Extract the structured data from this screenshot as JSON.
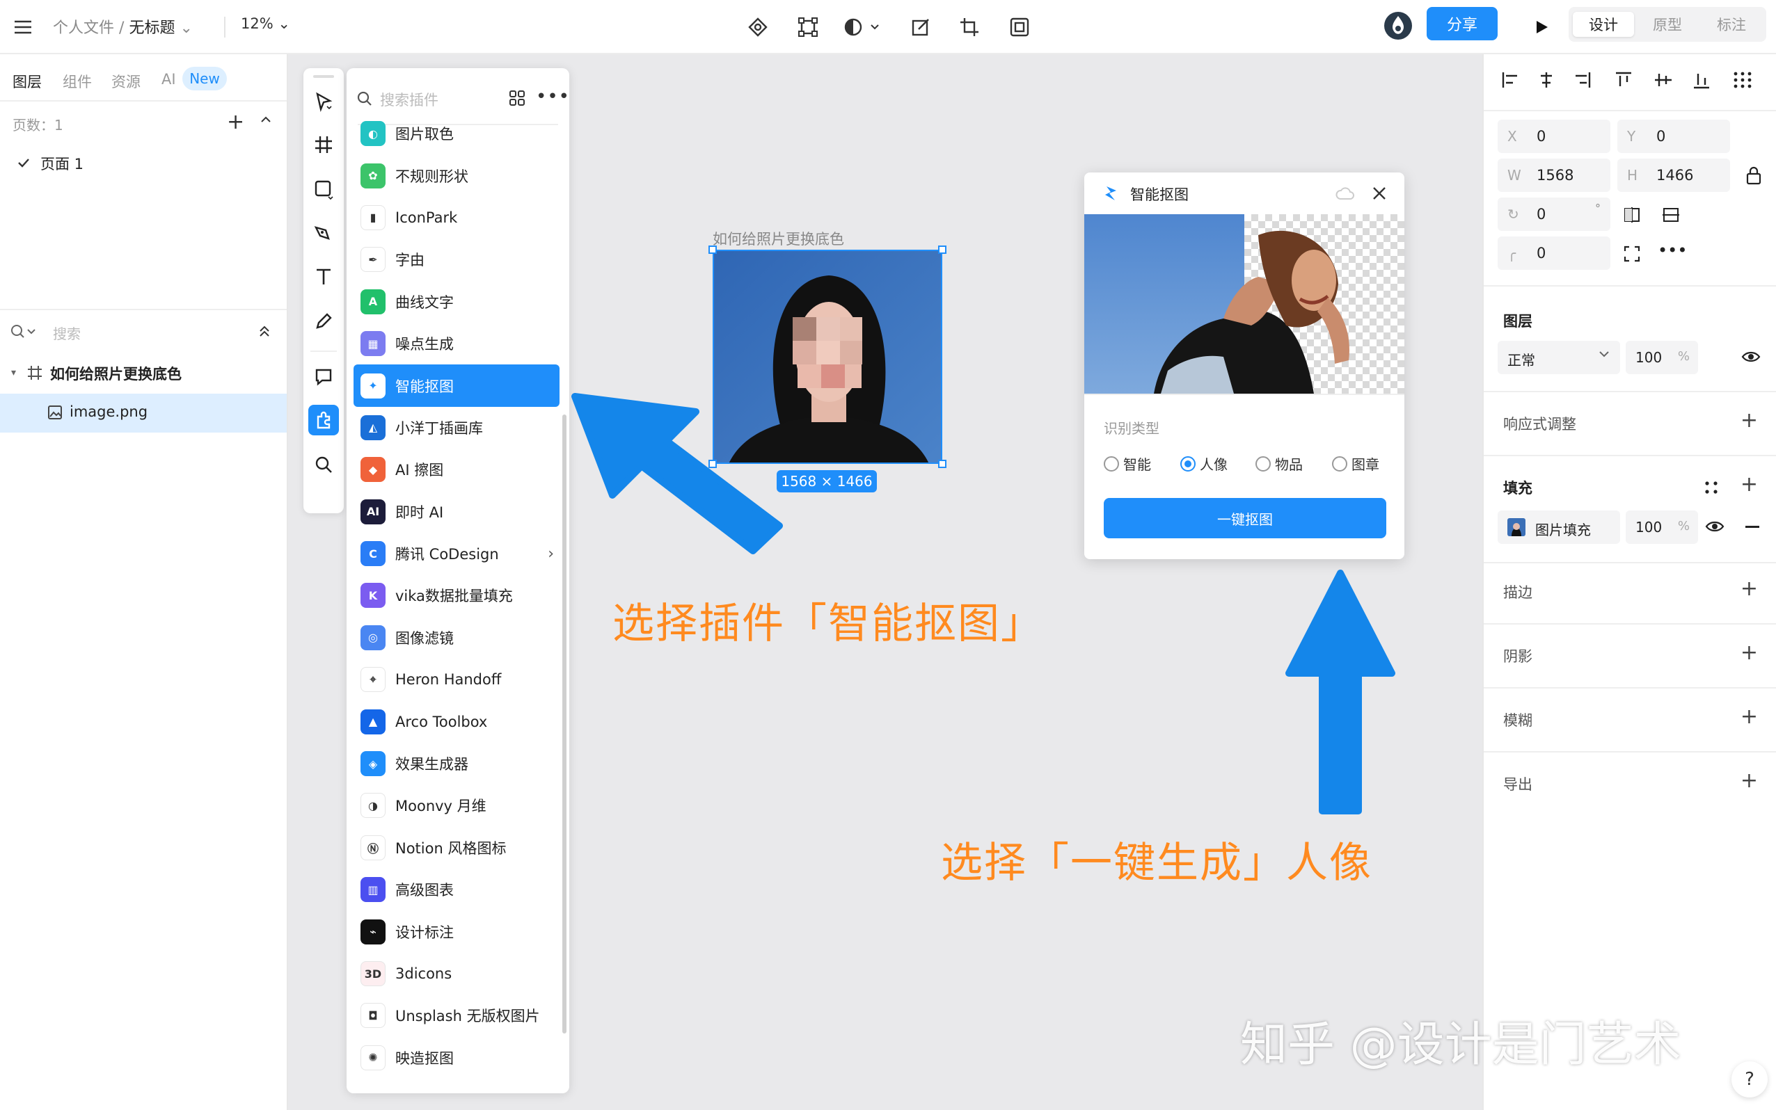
{
  "topbar": {
    "breadcrumb_parent": "个人文件",
    "breadcrumb_separator": "/",
    "breadcrumb_file": "无标题",
    "zoom": "12%",
    "share_label": "分享",
    "modes": [
      "设计",
      "原型",
      "标注"
    ],
    "active_mode": "设计",
    "toolbar_icons": [
      "component-icon",
      "frame-transform-icon",
      "mask-icon",
      "edit-image-icon",
      "crop-icon",
      "outline-icon"
    ]
  },
  "left": {
    "tabs": [
      "图层",
      "组件",
      "资源",
      "AI"
    ],
    "new_badge": "New",
    "pages_label": "页数：1",
    "page_item": "页面 1",
    "search_placeholder": "搜索",
    "frame_name": "如何给照片更换底色",
    "layer_name": "image.png"
  },
  "plugins": {
    "search_placeholder": "搜索插件",
    "items": [
      {
        "label": "图片取色",
        "color": "#22c3c3",
        "glyph": "◐"
      },
      {
        "label": "不规则形状",
        "color": "#3cc46a",
        "glyph": "✿"
      },
      {
        "label": "IconPark",
        "color": "#ffffff",
        "glyph": "▮"
      },
      {
        "label": "字由",
        "color": "#ffffff",
        "glyph": "✒"
      },
      {
        "label": "曲线文字",
        "color": "#21c06b",
        "glyph": "A"
      },
      {
        "label": "噪点生成",
        "color": "#7c7cf0",
        "glyph": "▦"
      },
      {
        "label": "智能抠图",
        "color": "#1f8efa",
        "glyph": "✦"
      },
      {
        "label": "小洋丁插画库",
        "color": "#1a6fd8",
        "glyph": "◭"
      },
      {
        "label": "AI 擦图",
        "color": "#f0623a",
        "glyph": "◆"
      },
      {
        "label": "即时 AI",
        "color": "#1c1c3a",
        "glyph": "AI"
      },
      {
        "label": "腾讯 CoDesign",
        "color": "#2a7df6",
        "glyph": "C"
      },
      {
        "label": "vika数据批量填充",
        "color": "#7b5cf0",
        "glyph": "K"
      },
      {
        "label": "图像滤镜",
        "color": "#4a86f2",
        "glyph": "◎"
      },
      {
        "label": "Heron Handoff",
        "color": "#ffffff",
        "glyph": "⌖"
      },
      {
        "label": "Arco Toolbox",
        "color": "#1466e8",
        "glyph": "▲"
      },
      {
        "label": "效果生成器",
        "color": "#1f8efa",
        "glyph": "◈"
      },
      {
        "label": "Moonvy 月维",
        "color": "#ffffff",
        "glyph": "◑"
      },
      {
        "label": "Notion 风格图标",
        "color": "#ffffff",
        "glyph": "Ⓝ"
      },
      {
        "label": "高级图表",
        "color": "#4b4ff0",
        "glyph": "▥"
      },
      {
        "label": "设计标注",
        "color": "#111111",
        "glyph": "⌁"
      },
      {
        "label": "3dicons",
        "color": "#fdeef0",
        "glyph": "3D"
      },
      {
        "label": "Unsplash 无版权图片",
        "color": "#ffffff",
        "glyph": "◘"
      },
      {
        "label": "映造抠图",
        "color": "#ffffff",
        "glyph": "✺"
      }
    ],
    "selected": "智能抠图",
    "submenu_item": "腾讯 CoDesign"
  },
  "canvas": {
    "frame_title": "如何给照片更换底色",
    "dimensions": "1568 × 1466",
    "annotation_1": "选择插件「智能抠图」",
    "annotation_2": "选择「一键生成」人像",
    "arrow_color": "#1486ea",
    "annotation_color": "#ff8a1f"
  },
  "dialog": {
    "title": "智能抠图",
    "type_label": "识别类型",
    "options": [
      "智能",
      "人像",
      "物品",
      "图章"
    ],
    "selected_option": "人像",
    "button_label": "一键抠图"
  },
  "right": {
    "x_label": "X",
    "x_value": "0",
    "y_label": "Y",
    "y_value": "0",
    "w_label": "W",
    "w_value": "1568",
    "h_label": "H",
    "h_value": "1466",
    "rotation_value": "0",
    "rotation_unit": "°",
    "radius_value": "0",
    "layer_section": "图层",
    "blend_mode": "正常",
    "opacity": "100",
    "percent": "%",
    "responsive_section": "响应式调整",
    "fill_section": "填充",
    "fill_type": "图片填充",
    "fill_opacity": "100",
    "stroke_section": "描边",
    "shadow_section": "阴影",
    "blur_section": "模糊",
    "export_section": "导出"
  },
  "watermark": "知乎 @设计是门艺术",
  "help": "?"
}
